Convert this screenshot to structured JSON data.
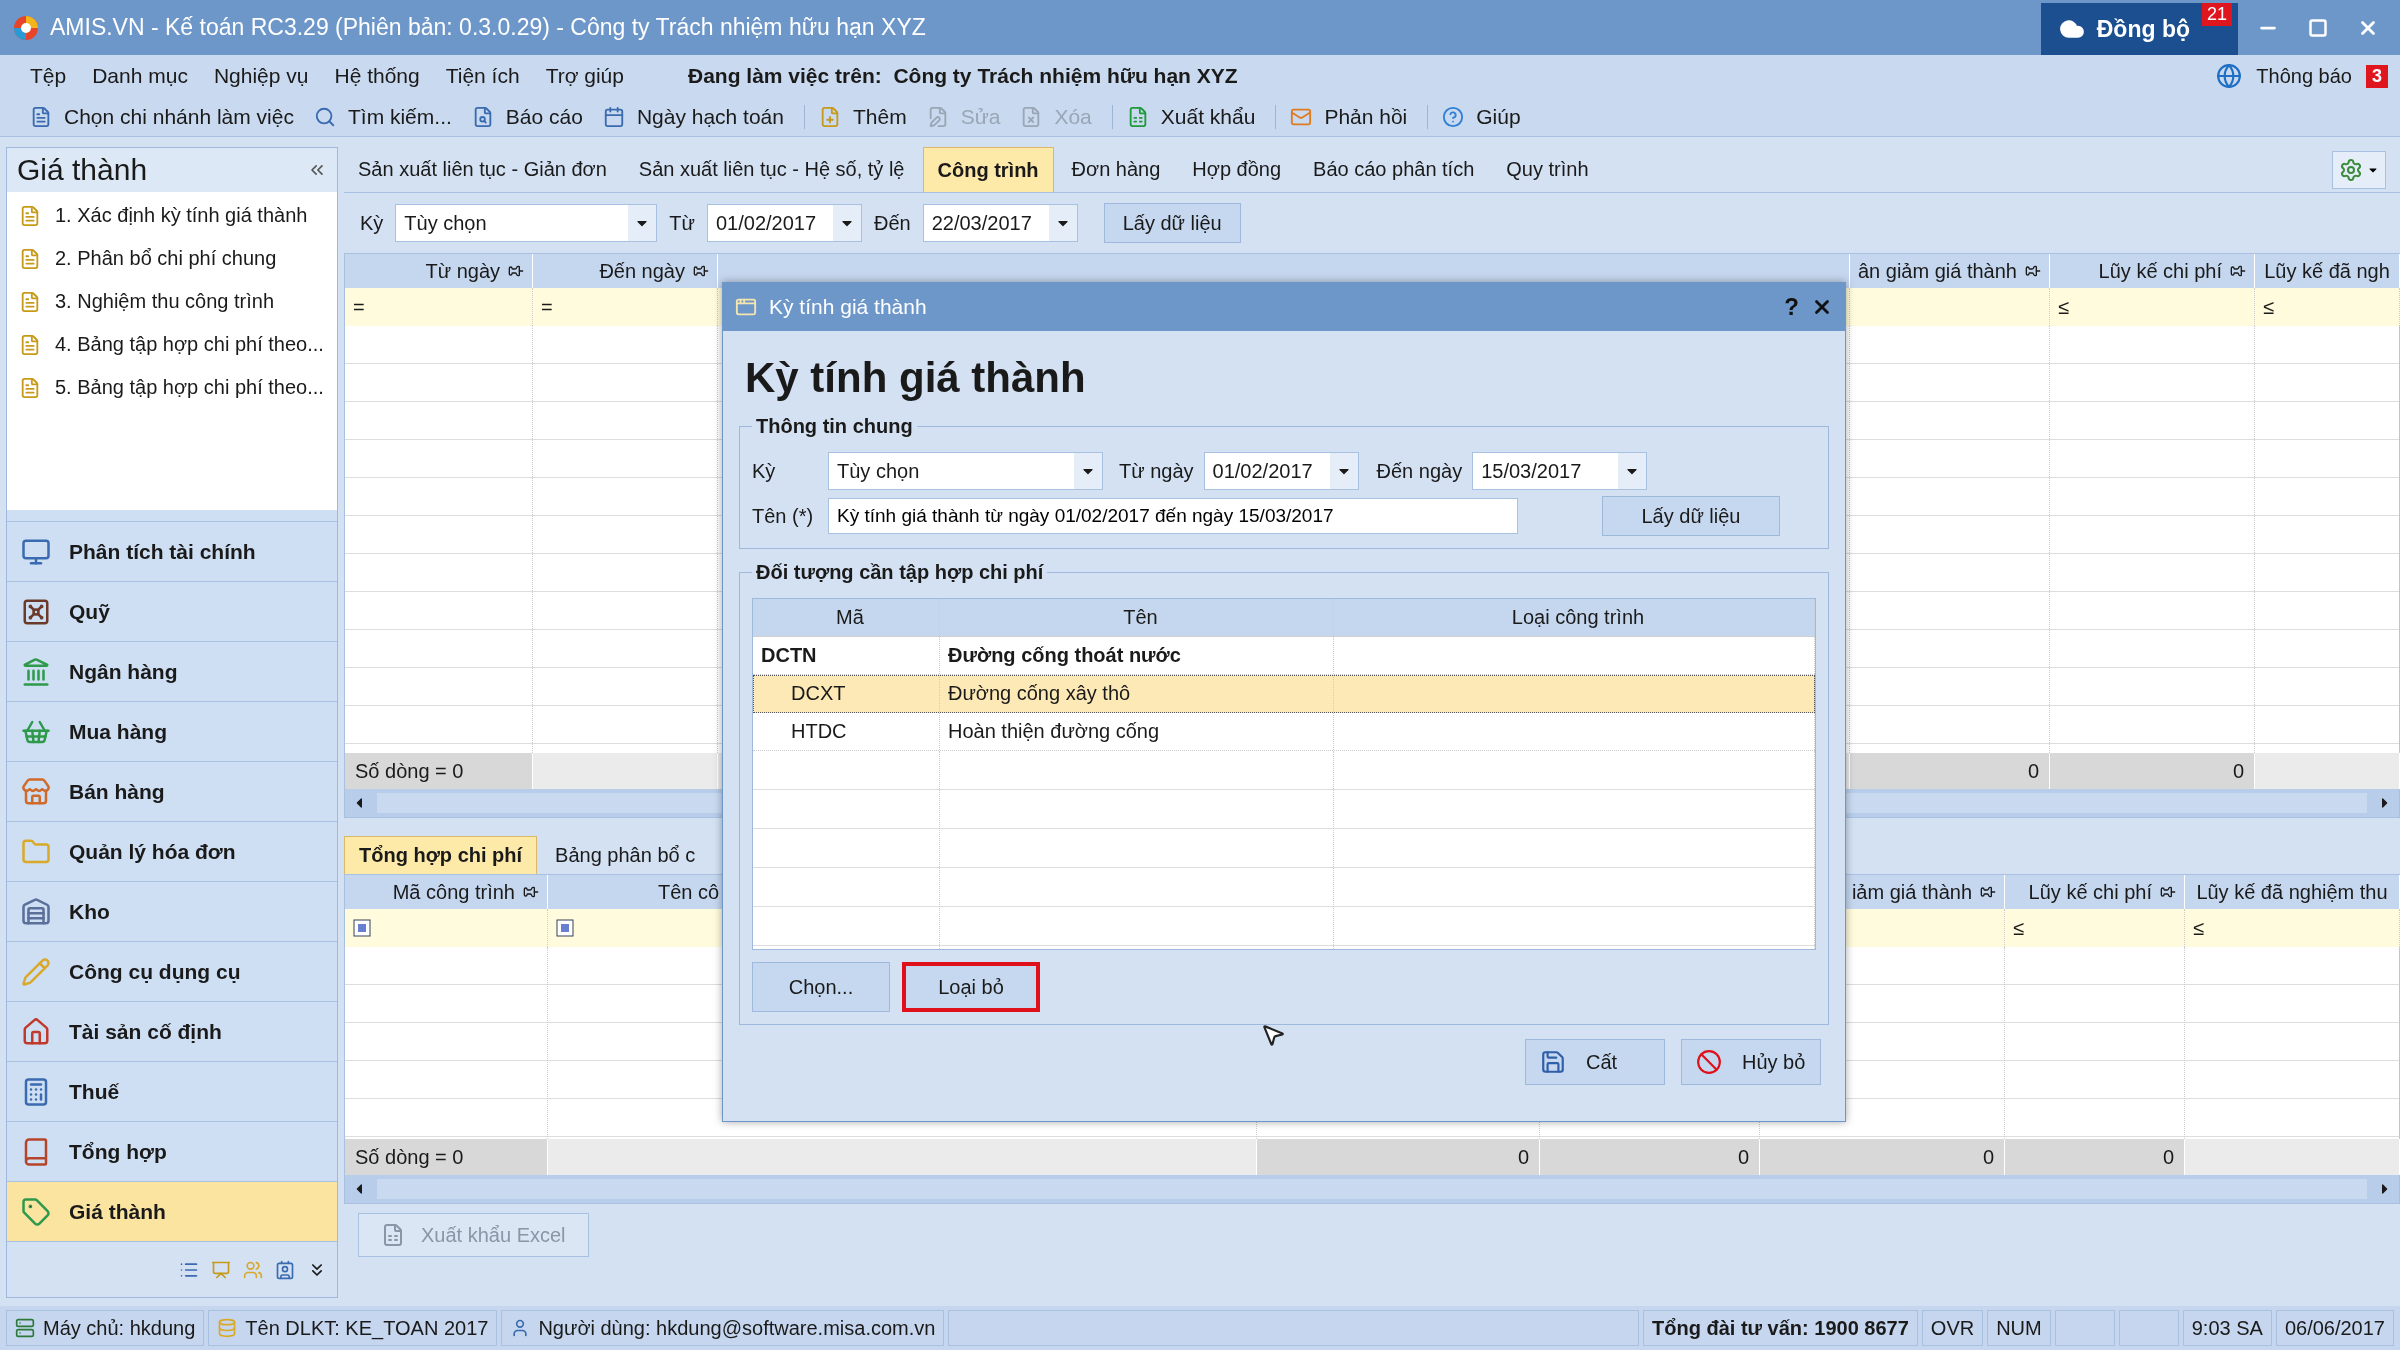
{
  "window": {
    "title": "AMIS.VN - Kế toán RC3.29 (Phiên bản: 0.3.0.29) - Công ty Trách nhiệm hữu hạn XYZ",
    "sync_button": {
      "label": "Đồng bộ",
      "badge": "21"
    }
  },
  "menu": [
    "Tệp",
    "Danh mục",
    "Nghiệp vụ",
    "Hệ thống",
    "Tiện ích",
    "Trợ giúp"
  ],
  "working_on": {
    "label": "Đang làm việc trên:",
    "company": "Công ty Trách nhiệm hữu hạn XYZ"
  },
  "notifications": {
    "label": "Thông báo",
    "badge": "3"
  },
  "toolbar": [
    {
      "label": "Chọn chi nhánh làm việc",
      "disabled": false,
      "separator_before": false
    },
    {
      "label": "Tìm kiếm...",
      "disabled": false,
      "separator_before": false
    },
    {
      "label": "Báo cáo",
      "disabled": false,
      "separator_before": false
    },
    {
      "label": "Ngày hạch toán",
      "disabled": false,
      "separator_before": false
    },
    {
      "label": "Thêm",
      "disabled": false,
      "separator_before": true
    },
    {
      "label": "Sửa",
      "disabled": true,
      "separator_before": false
    },
    {
      "label": "Xóa",
      "disabled": true,
      "separator_before": false
    },
    {
      "label": "Xuất khẩu",
      "disabled": false,
      "separator_before": true
    },
    {
      "label": "Phản hồi",
      "disabled": false,
      "separator_before": true
    },
    {
      "label": "Giúp",
      "disabled": false,
      "separator_before": true
    }
  ],
  "sidebar": {
    "title": "Giá thành",
    "tasks": [
      "1. Xác định kỳ tính giá thành",
      "2. Phân bổ chi phí chung",
      "3. Nghiệm thu công trình",
      "4. Bảng tập hợp chi phí theo...",
      "5. Bảng tập hợp chi phí theo..."
    ],
    "modules": [
      {
        "label": "Phân tích tài chính",
        "selected": false
      },
      {
        "label": "Quỹ",
        "selected": false
      },
      {
        "label": "Ngân hàng",
        "selected": false
      },
      {
        "label": "Mua hàng",
        "selected": false
      },
      {
        "label": "Bán hàng",
        "selected": false
      },
      {
        "label": "Quản lý hóa đơn",
        "selected": false
      },
      {
        "label": "Kho",
        "selected": false
      },
      {
        "label": "Công cụ dụng cụ",
        "selected": false
      },
      {
        "label": "Tài sản cố định",
        "selected": false
      },
      {
        "label": "Thuế",
        "selected": false
      },
      {
        "label": "Tổng hợp",
        "selected": false
      },
      {
        "label": "Giá thành",
        "selected": true
      }
    ]
  },
  "tabs": [
    {
      "label": "Sản xuất liên tục - Giản đơn",
      "selected": false
    },
    {
      "label": "Sản xuất liên tục - Hệ số, tỷ lệ",
      "selected": false
    },
    {
      "label": "Công trình",
      "selected": true
    },
    {
      "label": "Đơn hàng",
      "selected": false
    },
    {
      "label": "Hợp đồng",
      "selected": false
    },
    {
      "label": "Báo cáo phân tích",
      "selected": false
    },
    {
      "label": "Quy trình",
      "selected": false
    }
  ],
  "filter": {
    "period_label": "Kỳ",
    "period": "Tùy chọn",
    "from_label": "Từ",
    "from": "01/02/2017",
    "to_label": "Đến",
    "to": "22/03/2017",
    "button": "Lấy dữ liệu"
  },
  "upper_grid": {
    "columns": [
      {
        "label": "Từ ngày",
        "pinned": true
      },
      {
        "label": "Đến ngày",
        "pinned": true
      },
      {
        "label": "ân giảm giá thành",
        "pinned": true
      },
      {
        "label": "Lũy kế chi phí",
        "pinned": true
      },
      {
        "label": "Lũy kế đã ngh",
        "pinned": false
      }
    ],
    "filters": [
      "=",
      "=",
      "≤",
      "≤"
    ],
    "row_count": "Số dòng = 0",
    "totals": [
      "0",
      "0"
    ]
  },
  "lower_tabs": [
    {
      "label": "Tổng hợp chi phí",
      "selected": true
    },
    {
      "label": "Bảng phân bổ c",
      "selected": false
    }
  ],
  "lower_grid": {
    "columns": [
      {
        "label": "Mã công trình",
        "pinned": true
      },
      {
        "label": "Tên cô"
      },
      {
        "label": "iảm giá thành",
        "pinned": true
      },
      {
        "label": "Lũy kế chi phí",
        "pinned": true
      },
      {
        "label": "Lũy kế đã nghiệm thu",
        "pinned": false
      }
    ],
    "filters": [
      "≤",
      "≤"
    ],
    "row_count": "Số dòng = 0",
    "totals": [
      "0",
      "0",
      "0",
      "0"
    ]
  },
  "export_button": {
    "label": "Xuất khẩu Excel",
    "disabled": true
  },
  "dialog": {
    "title": "Kỳ tính giá thành",
    "help": "?",
    "heading": "Kỳ tính giá thành",
    "general": {
      "title": "Thông tin chung",
      "period_label": "Kỳ",
      "period": "Tùy chọn",
      "from_label": "Từ ngày",
      "from": "01/02/2017",
      "to_label": "Đến ngày",
      "to": "15/03/2017",
      "name_label": "Tên (*)",
      "name": "Kỳ tính giá thành từ ngày 01/02/2017 đến ngày 15/03/2017",
      "button": "Lấy dữ liệu"
    },
    "objects": {
      "title": "Đối tượng cần tập hợp chi phí",
      "columns": [
        "Mã",
        "Tên",
        "Loại công trình"
      ],
      "rows": [
        {
          "code": "DCTN",
          "name": "Đường cống thoát nước",
          "selected": false,
          "children": [
            {
              "code": "DCXT",
              "name": "Đường cống xây thô",
              "selected": true
            },
            {
              "code": "HTDC",
              "name": "Hoàn thiện đường cống",
              "selected": false
            }
          ]
        }
      ],
      "buttons": [
        {
          "label": "Chọn...",
          "highlighted": false
        },
        {
          "label": "Loại bỏ",
          "highlighted": true
        }
      ]
    },
    "footer_buttons": [
      {
        "label": "Cất",
        "kind": "save"
      },
      {
        "label": "Hủy bỏ",
        "kind": "cancel"
      }
    ]
  },
  "status_bar": [
    {
      "kind": "server",
      "label": "Máy chủ: hkdung"
    },
    {
      "kind": "database",
      "label": "Tên DLKT: KE_TOAN 2017"
    },
    {
      "kind": "user",
      "label": "Người dùng: hkdung@software.misa.com.vn"
    },
    {
      "kind": "blank"
    },
    {
      "kind": "bold",
      "label": "Tổng đài tư vấn: 1900 8677"
    },
    {
      "kind": "plain",
      "label": "OVR"
    },
    {
      "kind": "plain",
      "label": "NUM"
    },
    {
      "kind": "blank"
    },
    {
      "kind": "blank"
    },
    {
      "kind": "plain",
      "label": "9:03 SA"
    },
    {
      "kind": "plain",
      "label": "06/06/2017"
    }
  ]
}
